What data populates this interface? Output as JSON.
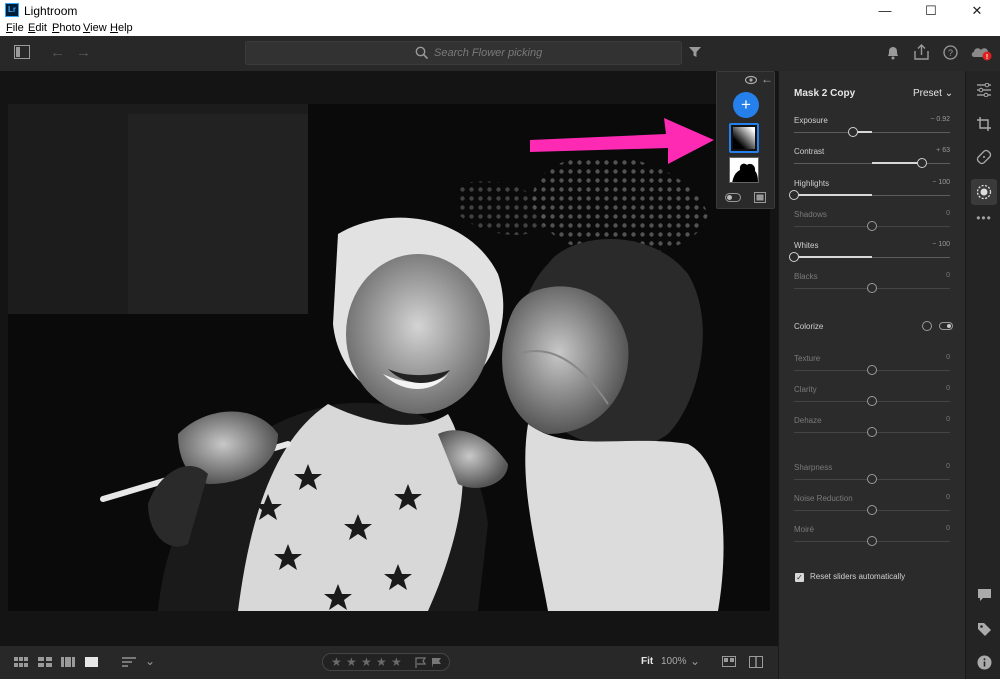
{
  "window": {
    "title": "Lightroom",
    "logo": "Lr",
    "minimize": "—",
    "maximize": "☐",
    "close": "✕"
  },
  "menu": [
    "File",
    "Edit",
    "Photo",
    "View",
    "Help"
  ],
  "toolbar": {
    "search_placeholder": "Search Flower picking"
  },
  "mask_panel": {
    "add_label": "+"
  },
  "panel": {
    "title": "Mask 2 Copy",
    "preset_label": "Preset",
    "sliders": [
      {
        "label": "Exposure",
        "value": "− 0.92",
        "fraction": 0.38,
        "dim": false
      },
      {
        "label": "Contrast",
        "value": "+ 63",
        "fraction": 0.82,
        "dim": false
      },
      {
        "label": "Highlights",
        "value": "− 100",
        "fraction": 0.0,
        "dim": false
      },
      {
        "label": "Shadows",
        "value": "0",
        "fraction": 0.5,
        "dim": true
      },
      {
        "label": "Whites",
        "value": "− 100",
        "fraction": 0.0,
        "dim": false
      },
      {
        "label": "Blacks",
        "value": "0",
        "fraction": 0.5,
        "dim": true
      },
      {
        "label": "Texture",
        "value": "0",
        "fraction": 0.5,
        "dim": true
      },
      {
        "label": "Clarity",
        "value": "0",
        "fraction": 0.5,
        "dim": true
      },
      {
        "label": "Dehaze",
        "value": "0",
        "fraction": 0.5,
        "dim": true
      },
      {
        "label": "Sharpness",
        "value": "0",
        "fraction": 0.5,
        "dim": true
      },
      {
        "label": "Noise Reduction",
        "value": "0",
        "fraction": 0.5,
        "dim": true
      },
      {
        "label": "Moiré",
        "value": "0",
        "fraction": 0.5,
        "dim": true
      }
    ],
    "colorize_label": "Colorize",
    "reset_label": "Reset sliders automatically",
    "reset_checked": true
  },
  "bottombar": {
    "fit_label": "Fit",
    "zoom": "100%"
  },
  "colors": {
    "accent": "#2680eb",
    "annotation": "#ff2ab4"
  }
}
